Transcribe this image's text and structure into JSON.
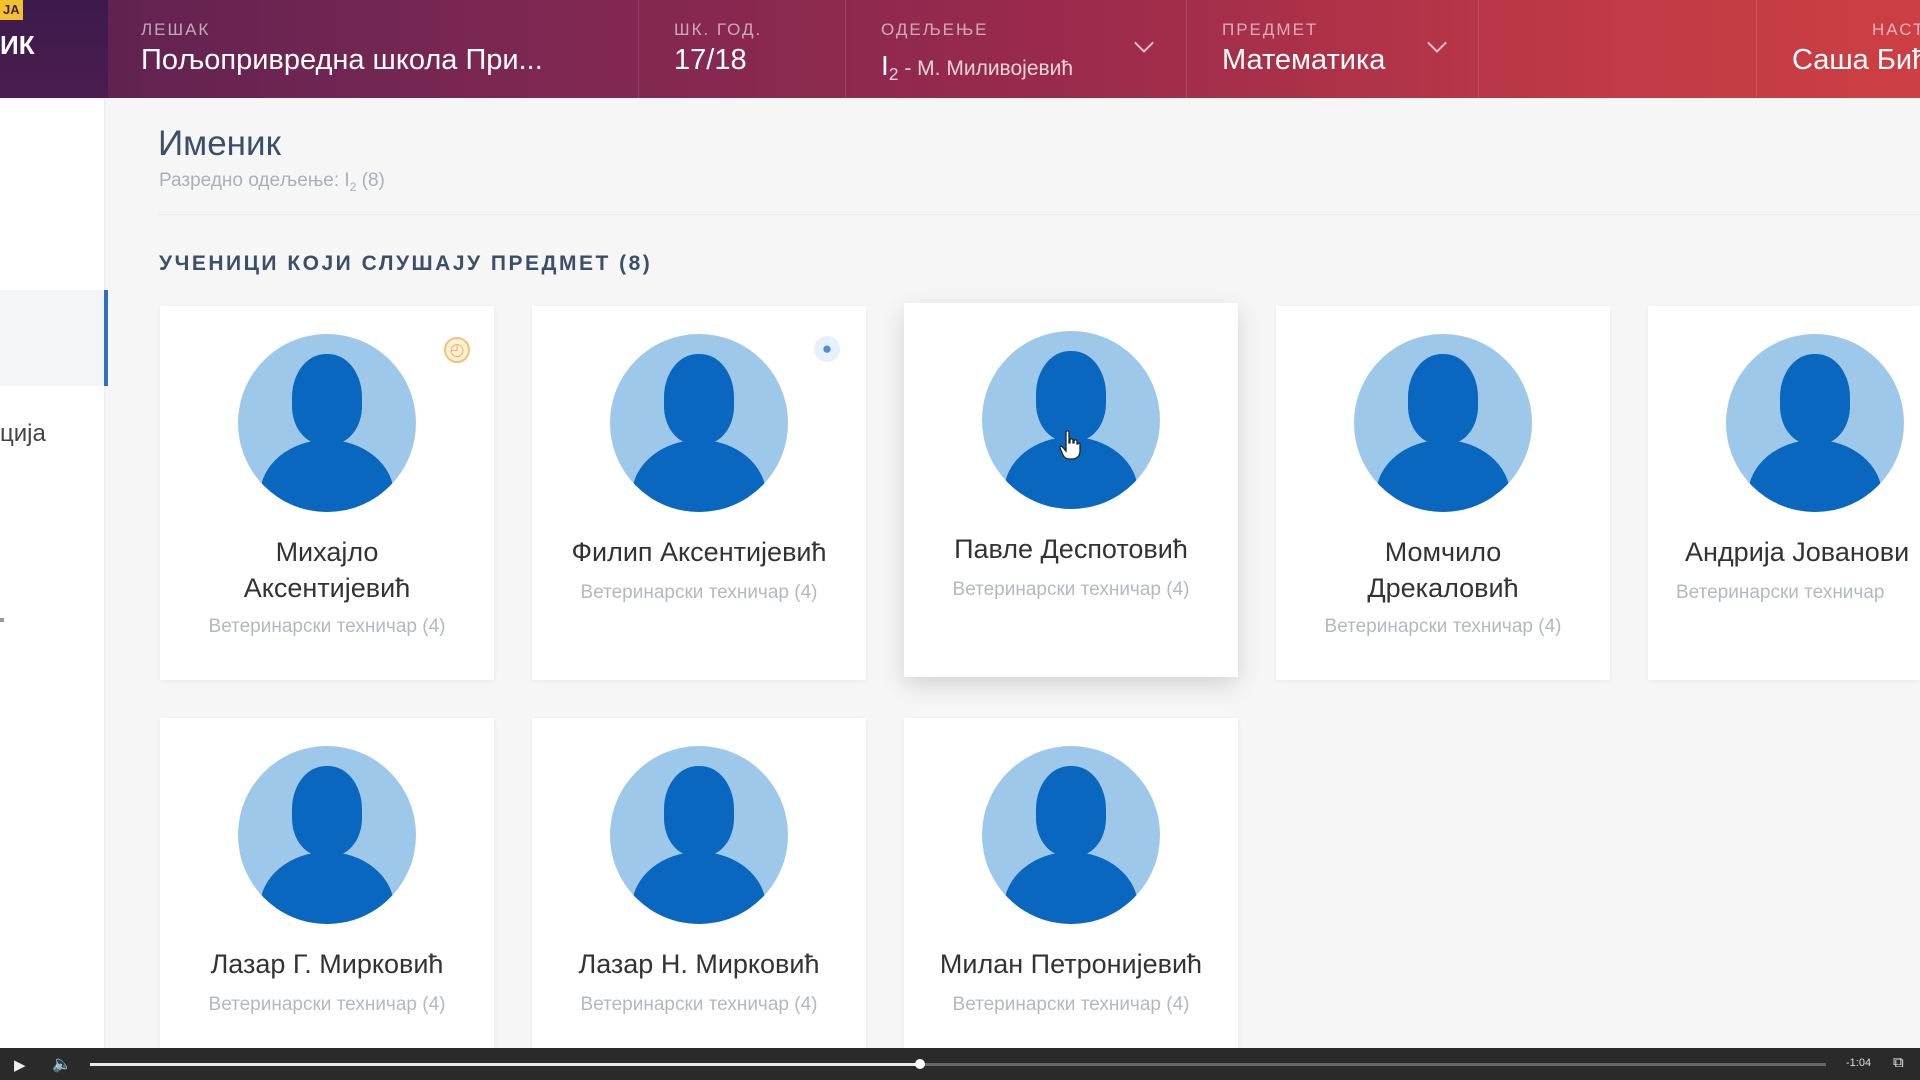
{
  "brand": {
    "badge": "ЈА",
    "label": "ИК"
  },
  "header": {
    "school": {
      "label": "ЛЕШАК",
      "value": "Пољопривредна школа При..."
    },
    "year": {
      "label": "ШК. ГОД.",
      "value": "17/18"
    },
    "class": {
      "label": "ОДЕЉЕЊЕ",
      "value_main": "I",
      "value_sub": "2",
      "value_rest": " - М. Миливојевић"
    },
    "subject": {
      "label": "ПРЕДМЕТ",
      "value": "Математика"
    },
    "teacher": {
      "label": "НАСТ",
      "value": "Саша Бић"
    }
  },
  "sidebar": {
    "partial_label": "ција"
  },
  "page": {
    "title": "Именик",
    "subtitle_prefix": "Разредно одељење: I",
    "subtitle_sub": "2",
    "subtitle_suffix": " (8)"
  },
  "section": {
    "heading": "УЧЕНИЦИ КОЈИ СЛУШАЈУ ПРЕДМЕТ (8)"
  },
  "students": [
    {
      "name_line1": "Михајло",
      "name_line2": "Аксентијевић",
      "program": "Ветеринарски техничар (4)",
      "badge": "clock"
    },
    {
      "name_line1": "Филип Аксентијевић",
      "name_line2": "",
      "program": "Ветеринарски техничар (4)",
      "badge": "chat"
    },
    {
      "name_line1": "Павле Деспотовић",
      "name_line2": "",
      "program": "Ветеринарски техничар (4)",
      "badge": ""
    },
    {
      "name_line1": "Момчило",
      "name_line2": "Дрекаловић",
      "program": "Ветеринарски техничар (4)",
      "badge": ""
    },
    {
      "name_line1": "Андрија Јованови",
      "name_line2": "",
      "program": "Ветеринарски техничар",
      "badge": ""
    },
    {
      "name_line1": "Лазар Г. Мирковић",
      "name_line2": "",
      "program": "Ветеринарски техничар (4)",
      "badge": ""
    },
    {
      "name_line1": "Лазар Н. Мирковић",
      "name_line2": "",
      "program": "Ветеринарски техничар (4)",
      "badge": ""
    },
    {
      "name_line1": "Милан Петронијевић",
      "name_line2": "",
      "program": "Ветеринарски техничар (4)",
      "badge": ""
    }
  ],
  "video": {
    "time": "-1:04",
    "progress": 0.478
  },
  "colors": {
    "accent": "#2f6fc1",
    "avatar_bg": "#9ec8e9",
    "avatar_fg": "#0a67c0",
    "header_start": "#5a2150",
    "header_end": "#cc3f44"
  }
}
